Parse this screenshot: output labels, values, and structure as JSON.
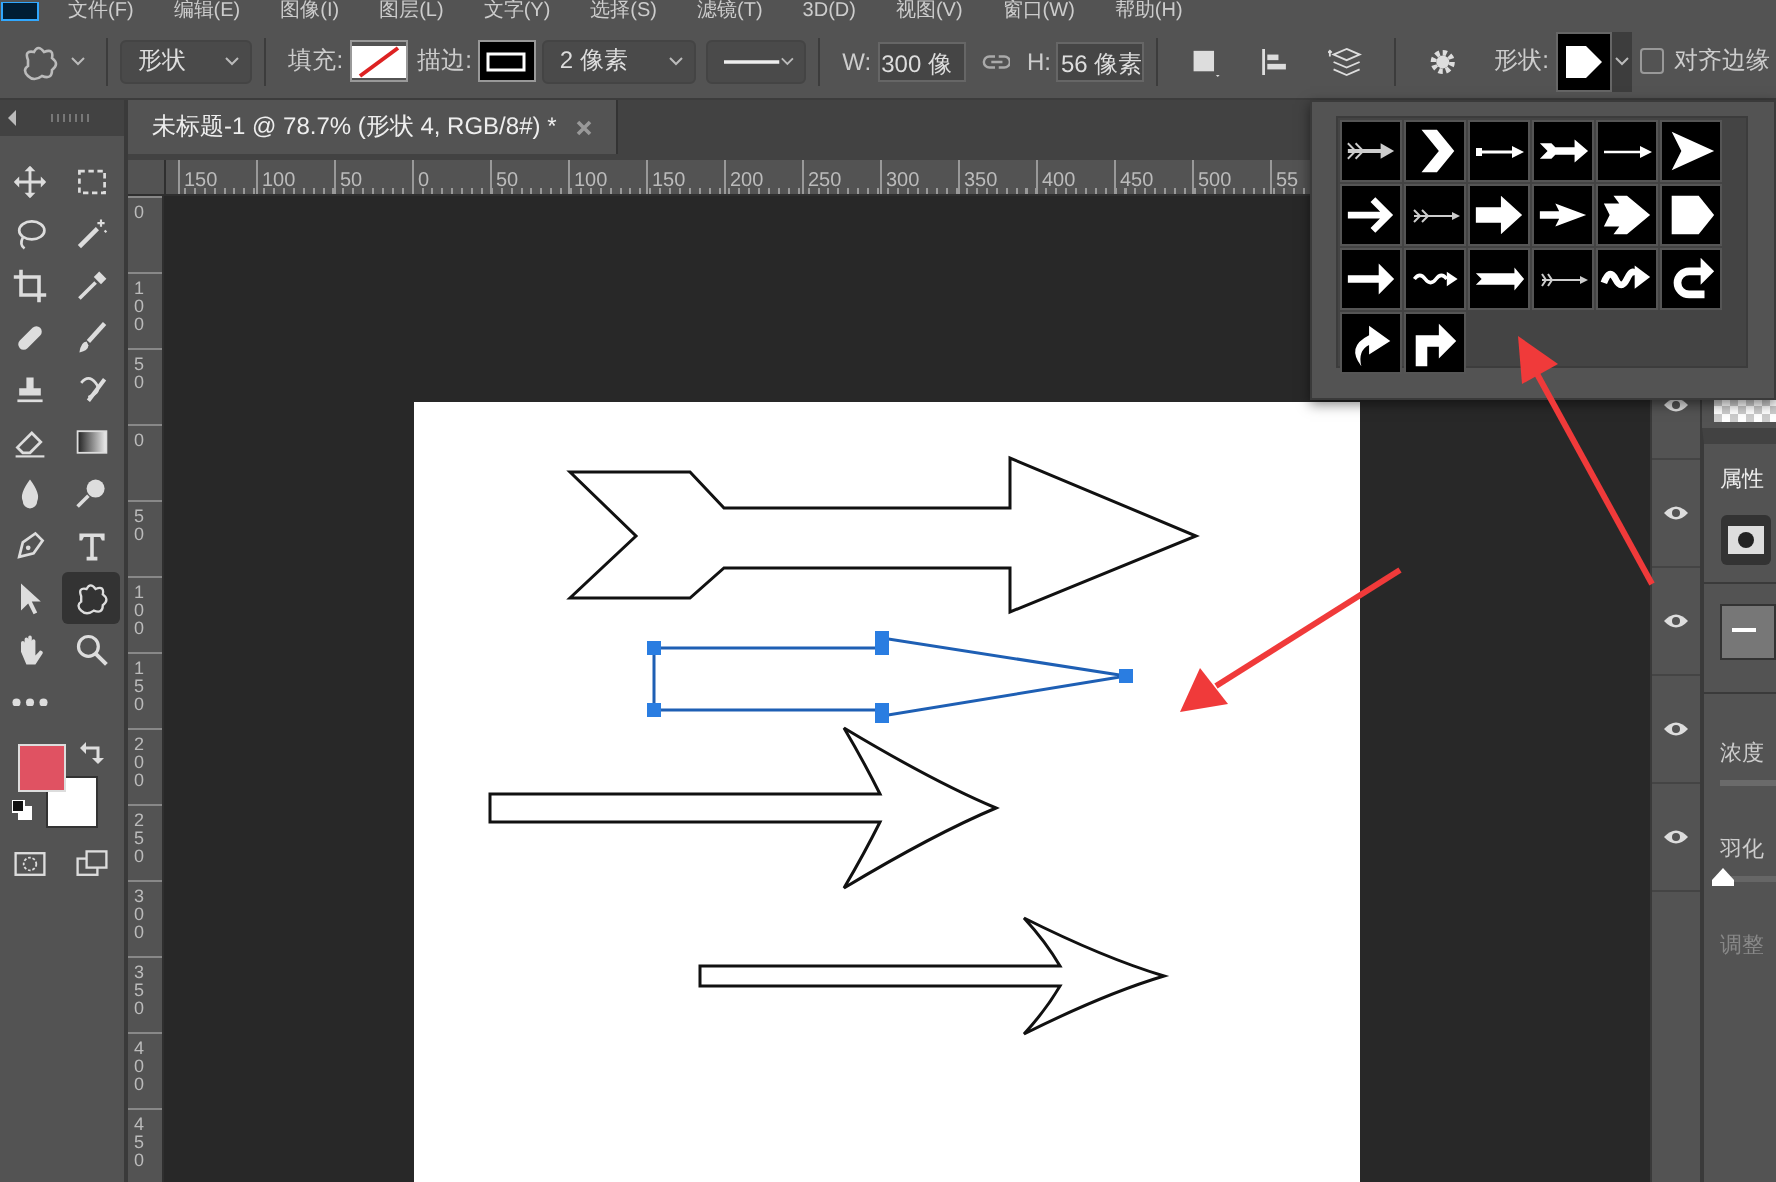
{
  "menu": [
    "文件(F)",
    "编辑(E)",
    "图像(I)",
    "图层(L)",
    "文字(Y)",
    "选择(S)",
    "滤镜(T)",
    "3D(D)",
    "视图(V)",
    "窗口(W)",
    "帮助(H)"
  ],
  "options_bar": {
    "mode": "形状",
    "fill_label": "填充:",
    "stroke_label": "描边:",
    "stroke_width": "2 像素",
    "w_label": "W:",
    "w_value": "300 像",
    "h_label": "H:",
    "h_value": "56 像素",
    "shape_label": "形状:",
    "align_edges": {
      "label": "对齐边缘",
      "checked": false
    }
  },
  "document_tab": {
    "title": "未标题-1 @ 78.7% (形状 4, RGB/8#) *",
    "selected": true
  },
  "ruler_h": [
    "150",
    "100",
    "50",
    "0",
    "50",
    "100",
    "150",
    "200",
    "250",
    "300",
    "350",
    "400",
    "450",
    "500",
    "55"
  ],
  "ruler_v": [
    "0",
    "100",
    "50",
    "0",
    "50",
    "100",
    "150",
    "200",
    "250",
    "300",
    "350",
    "400",
    "450"
  ],
  "tools": [
    {
      "selected": false
    },
    {
      "selected": false
    },
    {
      "selected": false
    },
    {
      "selected": false
    },
    {
      "selected": false
    },
    {
      "selected": false
    },
    {
      "selected": false
    },
    {
      "selected": false
    },
    {
      "selected": false
    },
    {
      "selected": false
    },
    {
      "selected": false
    },
    {
      "selected": false
    },
    {
      "selected": false
    },
    {
      "selected": false
    },
    {
      "selected": false
    },
    {
      "selected": false
    },
    {
      "selected": false
    },
    {
      "selected": true
    },
    {
      "selected": false
    },
    {
      "selected": false
    },
    {
      "selected": false
    },
    {
      "selected": false
    },
    {
      "selected": false
    }
  ],
  "canvas_shapes": [
    {
      "selected": false
    },
    {
      "selected": true
    },
    {
      "selected": false
    },
    {
      "selected": false
    }
  ],
  "layers": [
    {
      "visible": true
    },
    {
      "visible": true
    },
    {
      "visible": true
    },
    {
      "visible": true
    },
    {
      "visible": true
    }
  ],
  "properties": {
    "title": "属性",
    "density_label": "浓度",
    "feather_label": "羽化",
    "feather": {
      "level": 0
    },
    "adjust_label": "调整",
    "adjust_disabled": true
  }
}
